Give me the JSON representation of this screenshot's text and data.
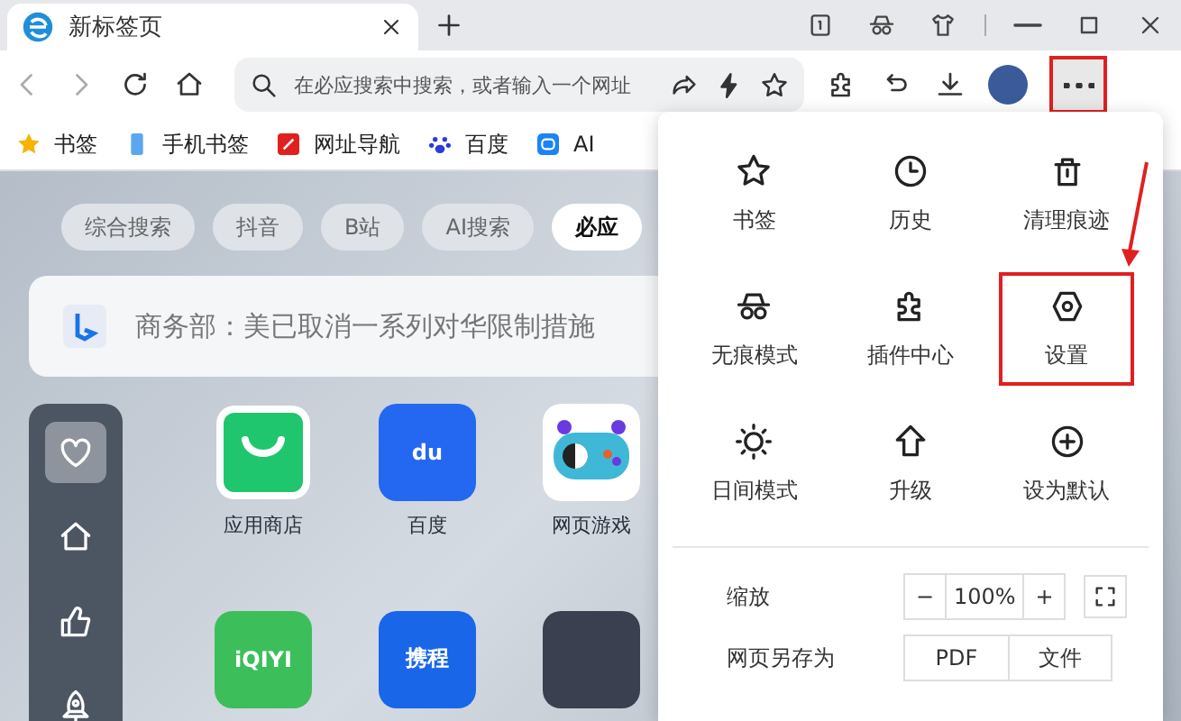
{
  "tab": {
    "title": "新标签页",
    "selected": true
  },
  "address_bar": {
    "placeholder": "在必应搜索中搜索，或者输入一个网址"
  },
  "more_button": {
    "highlighted": true
  },
  "bookmarks": [
    {
      "label": "书签",
      "kind": "star"
    },
    {
      "label": "手机书签",
      "kind": "phone"
    },
    {
      "label": "网址导航",
      "kind": "nav"
    },
    {
      "label": "百度",
      "kind": "paw"
    },
    {
      "label": "AI",
      "kind": "bot"
    }
  ],
  "search_tabs": [
    {
      "label": "综合搜索",
      "selected": false
    },
    {
      "label": "抖音",
      "selected": false
    },
    {
      "label": "B站",
      "selected": false
    },
    {
      "label": "AI搜索",
      "selected": false
    },
    {
      "label": "必应",
      "selected": true
    }
  ],
  "search_box": {
    "placeholder": "商务部：美已取消一系列对华限制措施"
  },
  "sidebar": {
    "items": [
      {
        "kind": "heart",
        "selected": true
      },
      {
        "kind": "home",
        "selected": false
      },
      {
        "kind": "thumb",
        "selected": false
      },
      {
        "kind": "rocket",
        "selected": false
      }
    ]
  },
  "apps": [
    {
      "label": "应用商店",
      "kind": "store"
    },
    {
      "label": "百度",
      "kind": "baidu",
      "logo_text": "du"
    },
    {
      "label": "网页游戏",
      "kind": "game"
    },
    {
      "kind": "iqiyi",
      "logo_text": "iQIYI"
    },
    {
      "kind": "ctrip",
      "logo_text": "携程"
    },
    {
      "kind": "photo"
    }
  ],
  "menu": {
    "items": [
      {
        "label": "书签",
        "kind": "star",
        "highlighted": false
      },
      {
        "label": "历史",
        "kind": "clock",
        "highlighted": false
      },
      {
        "label": "清理痕迹",
        "kind": "trash",
        "highlighted": false
      },
      {
        "label": "无痕模式",
        "kind": "incognito",
        "highlighted": false
      },
      {
        "label": "插件中心",
        "kind": "puzzle",
        "highlighted": false
      },
      {
        "label": "设置",
        "kind": "settings",
        "highlighted": true
      },
      {
        "label": "日间模式",
        "kind": "sun",
        "highlighted": false
      },
      {
        "label": "升级",
        "kind": "up",
        "highlighted": false
      },
      {
        "label": "设为默认",
        "kind": "plus",
        "highlighted": false
      }
    ],
    "zoom": {
      "label": "缩放",
      "minus": "−",
      "value": "100%",
      "plus": "+"
    },
    "save_as": {
      "label": "网页另存为",
      "buttons": [
        "PDF",
        "文件"
      ]
    }
  },
  "annotation": {
    "arrow": true
  }
}
